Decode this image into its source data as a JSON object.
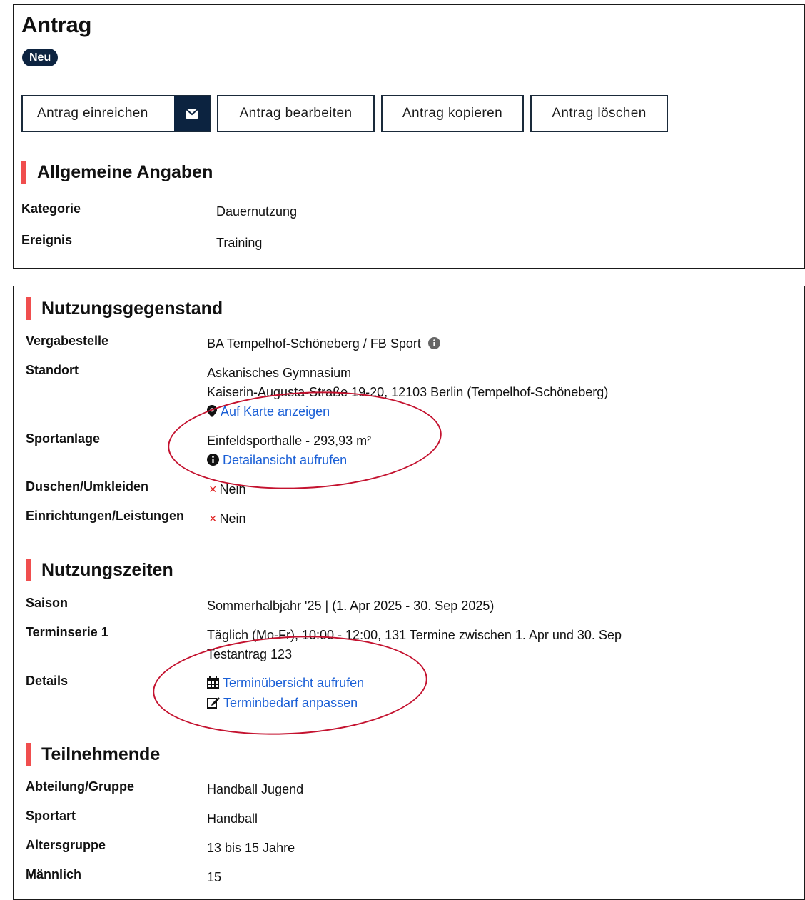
{
  "header": {
    "title": "Antrag",
    "status_badge": "Neu"
  },
  "actions": {
    "submit_label": "Antrag einreichen",
    "edit_label": "Antrag bearbeiten",
    "copy_label": "Antrag kopieren",
    "delete_label": "Antrag löschen"
  },
  "general": {
    "heading": "Allgemeine Angaben",
    "rows": [
      {
        "label": "Kategorie",
        "value": "Dauernutzung"
      },
      {
        "label": "Ereignis",
        "value": "Training"
      }
    ]
  },
  "subject": {
    "heading": "Nutzungsgegenstand",
    "vergabestelle_label": "Vergabestelle",
    "vergabestelle_value": "BA Tempelhof-Schöneberg / FB Sport",
    "standort_label": "Standort",
    "standort_name": "Askanisches Gymnasium",
    "standort_address": "Kaiserin-Augusta-Straße 19-20, 12103 Berlin (Tempelhof-Schöneberg)",
    "map_link": "Auf Karte anzeigen",
    "sportanlage_label": "Sportanlage",
    "sportanlage_value": "Einfeldsporthalle - 293,93 m²",
    "detail_link": "Detailansicht aufrufen",
    "duschen_label": "Duschen/Umkleiden",
    "duschen_value": "Nein",
    "einrichtungen_label": "Einrichtungen/Leistungen",
    "einrichtungen_value": "Nein"
  },
  "times": {
    "heading": "Nutzungszeiten",
    "saison_label": "Saison",
    "saison_value": "Sommerhalbjahr '25 | (1. Apr 2025 - 30. Sep 2025)",
    "serie_label": "Terminserie 1",
    "serie_value": "Täglich (Mo-Fr), 10:00 - 12:00, 131 Termine zwischen 1. Apr und 30. Sep",
    "serie_note": "Testantrag 123",
    "details_label": "Details",
    "overview_link": "Terminübersicht aufrufen",
    "adjust_link": "Terminbedarf anpassen"
  },
  "participants": {
    "heading": "Teilnehmende",
    "rows": [
      {
        "label": "Abteilung/Gruppe",
        "value": "Handball Jugend"
      },
      {
        "label": "Sportart",
        "value": "Handball"
      },
      {
        "label": "Altersgruppe",
        "value": "13 bis 15 Jahre"
      },
      {
        "label": "Männlich",
        "value": "15"
      }
    ]
  },
  "colors": {
    "navy": "#0c2340",
    "accent_bar": "#f04e4e",
    "link": "#1a5fd6",
    "annotation_ring": "#c4122f"
  }
}
